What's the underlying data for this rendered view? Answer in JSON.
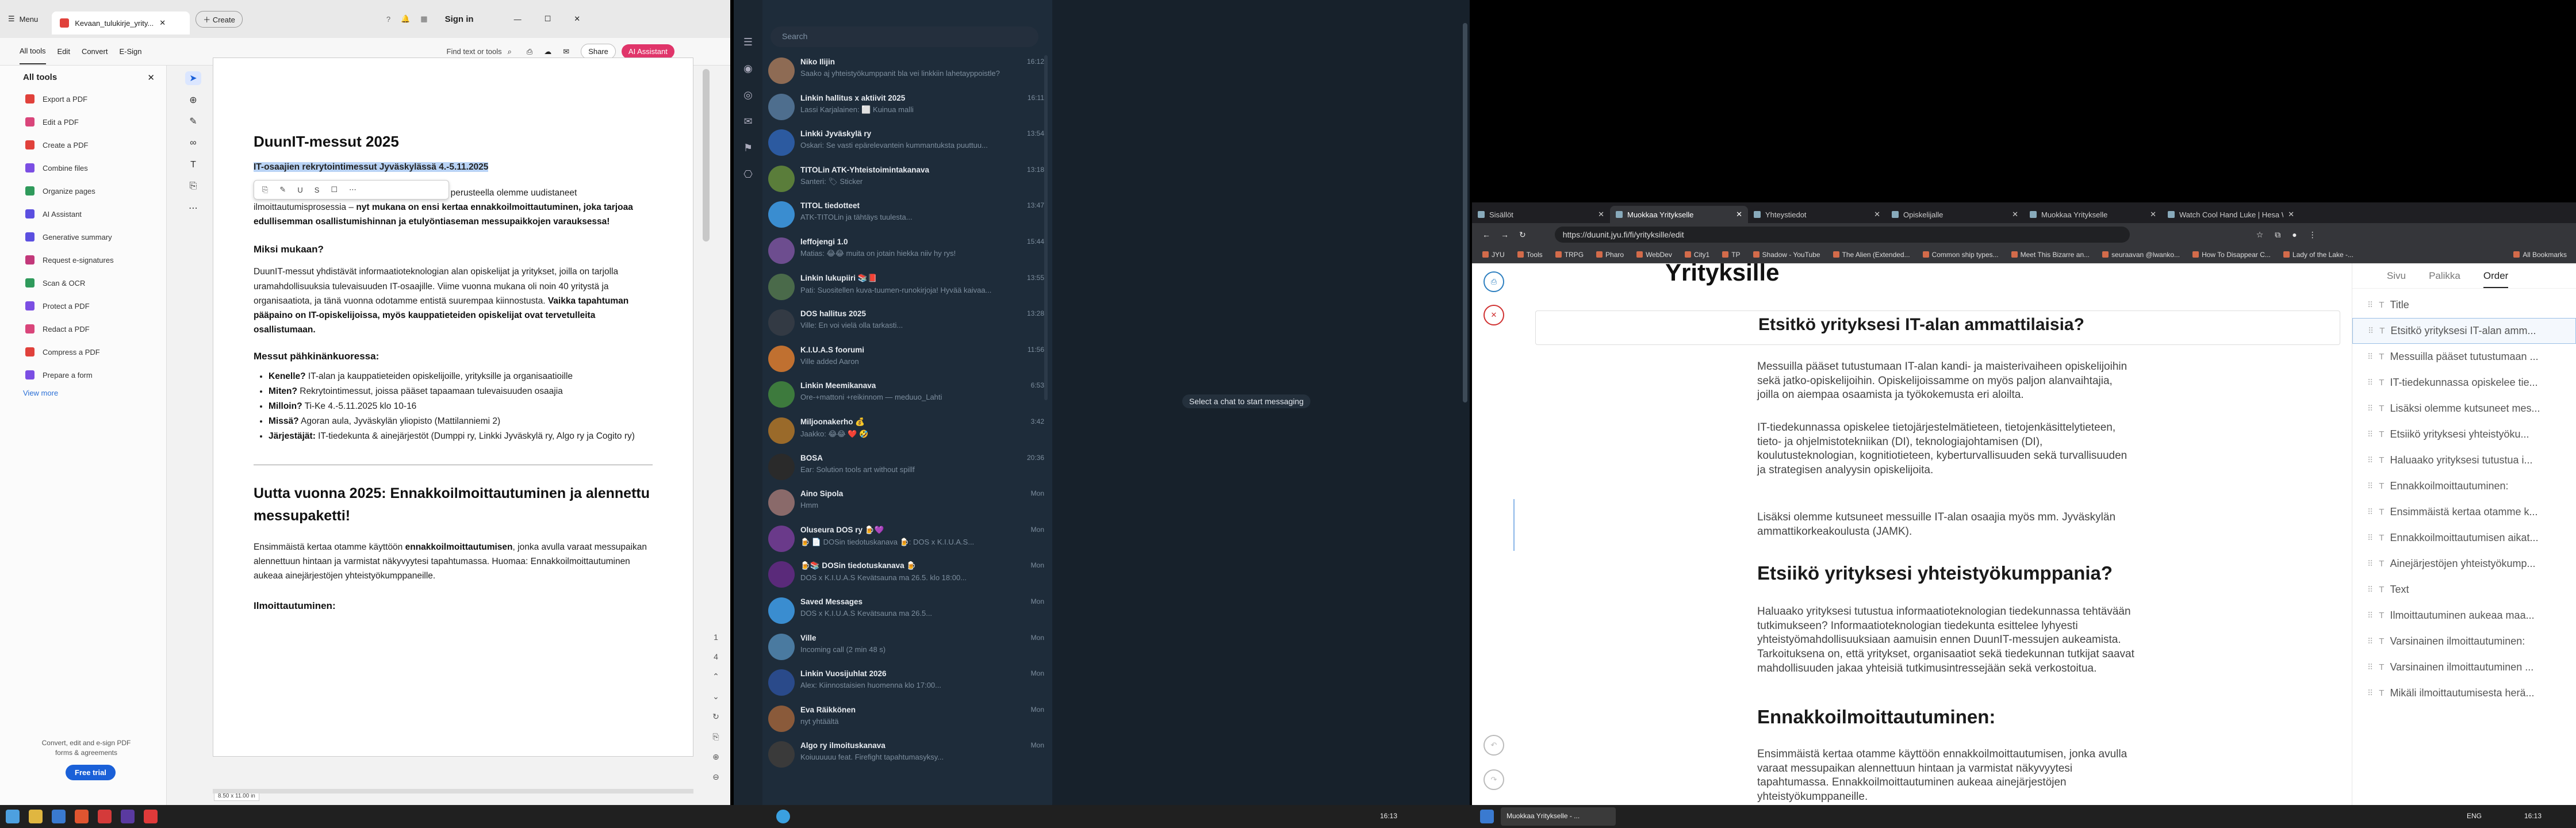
{
  "pdf": {
    "menu": "Menu",
    "tab_title": "Kevaan_tulukirje_yrity...",
    "create": "Create",
    "sign_in": "Sign in",
    "toolbar": {
      "all_tools": "All tools",
      "edit": "Edit",
      "convert": "Convert",
      "esign": "E-Sign",
      "find": "Find text or tools",
      "share": "Share",
      "ai": "AI Assistant"
    },
    "sidebar": {
      "title": "All tools",
      "items": [
        {
          "label": "Export a PDF",
          "color": "#e0413b"
        },
        {
          "label": "Edit a PDF",
          "color": "#d9457a"
        },
        {
          "label": "Create a PDF",
          "color": "#e0413b"
        },
        {
          "label": "Combine files",
          "color": "#7b4ee3"
        },
        {
          "label": "Organize pages",
          "color": "#2f9a5b"
        },
        {
          "label": "AI Assistant",
          "color": "#5b4fe0"
        },
        {
          "label": "Generative summary",
          "color": "#5b4fe0"
        },
        {
          "label": "Request e-signatures",
          "color": "#c2387a"
        },
        {
          "label": "Scan & OCR",
          "color": "#2f9a5b"
        },
        {
          "label": "Protect a PDF",
          "color": "#7b4ee3"
        },
        {
          "label": "Redact a PDF",
          "color": "#d9457a"
        },
        {
          "label": "Compress a PDF",
          "color": "#e0413b"
        },
        {
          "label": "Prepare a form",
          "color": "#7b4ee3"
        }
      ],
      "view_more": "View more",
      "promo": "Convert, edit and e-sign PDF forms & agreements",
      "trial": "Free trial"
    },
    "page_size": "8.50 x 11.00 in",
    "doc": {
      "h1": "DuunIT-messut 2025",
      "highlight": "IT-osaajien rekrytointimessut Jyväskylässä 4.-5.11.2025",
      "intro": "…e DuunIT-messuille! Viime vuoden kokemusten perusteella olemme uudistaneet ilmoittautumisprosessia – ",
      "intro_b": "nyt mukana on ensi kertaa ennakkoilmoittautuminen, joka tarjoaa edullisemman osallistumishinnan ja etulyöntiaseman messupaikkojen varauksessa!",
      "why_h": "Miksi mukaan?",
      "why_p": "DuunIT-messut yhdistävät informaatioteknologian alan opiskelijat ja yritykset, joilla on tarjolla uramahdollisuuksia tulevaisuuden IT-osaajille. Viime vuonna mukana oli noin 40 yritystä ja organisaatiota, ja tänä vuonna odotamme entistä suurempaa kiinnostusta. ",
      "why_b": "Vaikka tapahtuman pääpaino on IT-opiskelijoissa, myös kauppatieteiden opiskelijat ovat tervetulleita osallistumaan.",
      "facts_h": "Messut pähkinänkuoressa:",
      "facts": [
        {
          "k": "Kenelle?",
          "v": "IT-alan ja kauppatieteiden opiskelijoille, yrityksille ja organisaatioille"
        },
        {
          "k": "Miten?",
          "v": "Rekrytointimessut, joissa pääset tapaamaan tulevaisuuden osaajia"
        },
        {
          "k": "Milloin?",
          "v": "Ti-Ke 4.-5.11.2025 klo 10-16"
        },
        {
          "k": "Missä?",
          "v": "Agoran aula, Jyväskylän yliopisto (Mattilanniemi 2)"
        },
        {
          "k": "Järjestäjät:",
          "v": "IT-tiedekunta & ainejärjestöt (Dumppi ry, Linkki Jyväskylä ry, Algo ry ja Cogito ry)"
        }
      ],
      "new_h": "Uutta vuonna 2025: Ennakkoilmoittautuminen ja alennettu messupaketti!",
      "new_p1": "Ensimmäistä kertaa otamme käyttöön ",
      "new_b": "ennakkoilmoittautumisen",
      "new_p2": ", jonka avulla varaat messupaikan alennettuun hintaan ja varmistat näkyvyytesi tapahtumassa. Huomaa: Ennakkoilmoittautuminen aukeaa ainejärjestöjen yhteistyökumppaneille.",
      "reg_h": "Ilmoittautuminen:"
    }
  },
  "telegram": {
    "search": "Search",
    "empty": "Select a chat to start messaging",
    "chats": [
      {
        "name": "Niko Ilijin",
        "time": "16:12",
        "msg": "Saako aj yhteistyökumppanit bla vei linkkiin lahetayppoistle?",
        "color": "#8e6b54"
      },
      {
        "name": "Linkin hallitus x aktiivit 2025",
        "time": "16:11",
        "msg": "Lassi Karjalainen: ⬜ Kuinua malli",
        "color": "#4e6e8e"
      },
      {
        "name": "Linkki Jyväskylä ry",
        "time": "13:54",
        "msg": "Oskari: Se vasti epärelevantein kummantuksta puuttuu...",
        "color": "#2c5aa0"
      },
      {
        "name": "TITOLin ATK-Yhteistoimintakanava",
        "time": "13:18",
        "msg": "Santeri: 🏷 Sticker",
        "color": "#5a7d3a"
      },
      {
        "name": "TITOL tiedotteet",
        "time": "13:47",
        "msg": "ATK-TITOLin ja tähtäys tuulesta...",
        "color": "#3a8dd0"
      },
      {
        "name": "leffojengi 1.0",
        "time": "15:44",
        "msg": "Matias: 😂😂 muita on jotain hiekka niiv hy rys!",
        "color": "#6d4d8f"
      },
      {
        "name": "Linkin lukupiiri 📚📕",
        "time": "13:55",
        "msg": "Pati: Suositellen kuva-tuumen-runokirjoja! Hyvää kaivaa...",
        "color": "#4a6a4a"
      },
      {
        "name": "DOS hallitus 2025",
        "time": "13:28",
        "msg": "Ville: En voi vielä olla tarkasti...",
        "color": "#333a44"
      },
      {
        "name": "K.I.U.A.S foorumi",
        "time": "11:56",
        "msg": "Ville added Aaron",
        "color": "#c07030"
      },
      {
        "name": "Linkin Meemikanava",
        "time": "6:53",
        "msg": "Ore-+mattoni +reikinnom — meduuo_Lahti",
        "color": "#3d7a3d"
      },
      {
        "name": "Miljoonakerho 💰",
        "time": "3:42",
        "msg": "Jaakko: 😂😂 ❤️ 🤣",
        "color": "#9a6a2a"
      },
      {
        "name": "BOSA",
        "time": "20:36",
        "msg": "Ear: Solution tools art without spillf",
        "color": "#2a2a2a"
      },
      {
        "name": "Aino Sipola",
        "time": "Mon",
        "msg": "Hmm",
        "color": "#8a6a6a"
      },
      {
        "name": "Oluseura DOS ry 🍺💜",
        "time": "Mon",
        "msg": "🍺 📄 DOSin tiedotuskanava 🍺: DOS x K.I.U.A.S...",
        "color": "#6a3a8a"
      },
      {
        "name": "🍺📚 DOSin tiedotuskanava 🍺",
        "time": "Mon",
        "msg": "DOS x K.I.U.A.S Kevätsauna ma 26.5. klo 18:00...",
        "color": "#5a2a7a"
      },
      {
        "name": "Saved Messages",
        "time": "Mon",
        "msg": "DOS x K.I.U.A.S Kevätsauna ma 26.5...",
        "color": "#3a8dd0"
      },
      {
        "name": "Ville",
        "time": "Mon",
        "msg": "Incoming call (2 min 48 s)",
        "color": "#4a7aa0"
      },
      {
        "name": "Linkin Vuosijuhlat 2026",
        "time": "Mon",
        "msg": "Alex: Kiinnostaisien huomenna klo 17:00...",
        "color": "#2a4a8a"
      },
      {
        "name": "Eva Räikkönen",
        "time": "Mon",
        "msg": "nyt yhtäältä",
        "color": "#8a5a3a"
      },
      {
        "name": "Algo ry ilmoituskanava",
        "time": "Mon",
        "msg": "Koiuuuuuu feat. Firefight tapahtumasyksy...",
        "color": "#3a3a3a"
      }
    ]
  },
  "browser": {
    "tabs": [
      "Sisällöt",
      "Muokkaa Yritykselle",
      "Yhteystiedot",
      "Opiskelijalle",
      "Muokkaa Yritykselle",
      "Watch Cool Hand Luke | Hesa Wer..."
    ],
    "url": "https://duunit.jyu.fi/fi/yrityksille/edit",
    "bookmarks": [
      "JYU",
      "Tools",
      "TRPG",
      "Pharo",
      "WebDev",
      "City1",
      "TP",
      "Shadow - YouTube",
      "The Alien (Extended...",
      "Common ship types...",
      "Meet This Bizarre an...",
      "seuraavan @lwanko...",
      "How To Disappear C...",
      "Lady of the Lake -..."
    ],
    "all_bookmarks": "All Bookmarks",
    "editor": {
      "title": "Yrityksille",
      "h1": "Etsitkö yrityksesi IT-alan ammattilaisia?",
      "p1": "Messuilla pääset tutustumaan IT-alan kandi- ja maisterivaiheen opiskelijoihin sekä jatko-opiskelijoihin. Opiskelijoissamme on myös paljon alanvaihtajia, joilla on aiempaa osaamista ja työkokemusta eri aloilta.",
      "p2": "IT-tiedekunnassa opiskelee tietojärjestelmätieteen, tietojenkäsittelytieteen, tieto- ja ohjelmistotekniikan (DI), teknologiajohtamisen (DI), koulutusteknologian, kognitiotieteen, kyberturvallisuuden sekä turvallisuuden ja strategisen analyysin opiskelijoita.",
      "p3": "Lisäksi olemme kutsuneet messuille IT-alan osaajia myös mm. Jyväskylän ammattikorkeakoulusta (JAMK).",
      "h2": "Etsiikö yrityksesi yhteistyökumppania?",
      "p4": "Haluaako yrityksesi tutustua informaatioteknologian tiedekunnassa tehtävään tutkimukseen? Informaatioteknologian tiedekunta esittelee lyhyesti yhteistyömahdollisuuksiaan aamuisin ennen DuunIT-messujen aukeamista. Tarkoituksena on, että yritykset, organisaatiot sekä tiedekunnan tutkijat saavat mahdollisuuden jakaa yhteisiä tutkimusintressejään sekä verkostoitua.",
      "h3": "Ennakkoilmoittautuminen:",
      "p5": "Ensimmäistä kertaa otamme käyttöön ennakkoilmoittautumisen, jonka avulla varaat messupaikan alennettuun hintaan ja varmistat näkyvyytesi tapahtumassa. Ennakkoilmoittautuminen aukeaa ainejärjestöjen yhteistyökumppaneille."
    },
    "panel": {
      "tabs": [
        "Sivu",
        "Palikka",
        "Order"
      ],
      "items": [
        "Title",
        "Etsitkö yrityksesi IT-alan amm...",
        "Messuilla pääset tutustumaan ...",
        "IT-tiedekunnassa opiskelee tie...",
        "Lisäksi olemme kutsuneet mes...",
        "Etsiikö yrityksesi yhteistyöku...",
        "Haluaako yrityksesi tutustua i...",
        "Ennakkoilmoittautuminen:",
        "Ensimmäistä kertaa otamme k...",
        "Ennakkoilmoittautumisen aikat...",
        "Ainejärjestöjen yhteistyökump...",
        "Text",
        "Ilmoittautuminen aukeaa maa...",
        "Varsinainen ilmoittautuminen:",
        "Varsinainen ilmoittautuminen ...",
        "Mikäli ilmoittautumisesta herä..."
      ]
    }
  },
  "taskbar": {
    "time1": "16:13",
    "lang": "ENG",
    "time2": "16:13",
    "app": "Muokkaa Yritykselle - ..."
  }
}
